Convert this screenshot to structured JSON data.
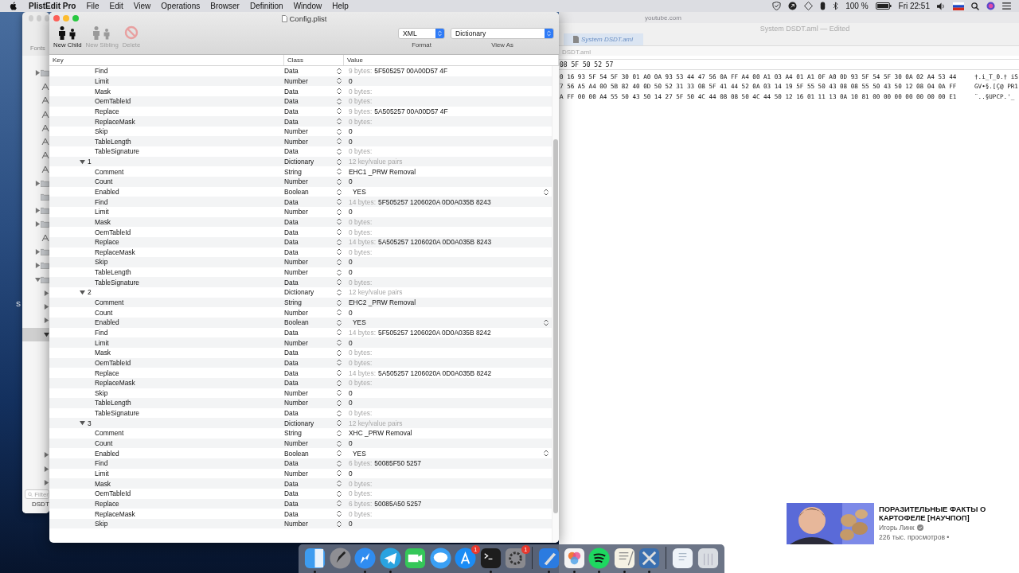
{
  "menubar": {
    "app_name": "PlistEdit Pro",
    "menus": [
      "File",
      "Edit",
      "View",
      "Operations",
      "Browser",
      "Definition",
      "Window",
      "Help"
    ],
    "battery_text": "100 %",
    "clock": "Fri 22:51"
  },
  "desktop": {
    "label": "S"
  },
  "back_window": {
    "toolbar_label": "Fonts",
    "filter_placeholder": "Filter",
    "bottom_tab": "DSDT",
    "items": [
      {
        "kind": "folder",
        "expanded": false
      },
      {
        "kind": "font"
      },
      {
        "kind": "font"
      },
      {
        "kind": "font"
      },
      {
        "kind": "font"
      },
      {
        "kind": "font"
      },
      {
        "kind": "font"
      },
      {
        "kind": "font"
      },
      {
        "kind": "folder",
        "expanded": false
      },
      {
        "kind": "folder"
      },
      {
        "kind": "folder",
        "expanded": false
      },
      {
        "kind": "folder",
        "expanded": false
      },
      {
        "kind": "font"
      },
      {
        "kind": "folder",
        "expanded": false
      },
      {
        "kind": "folder",
        "expanded": false
      },
      {
        "kind": "folder",
        "expanded": true,
        "children": [
          {
            "expanded": false,
            "selected": false
          },
          {
            "expanded": false,
            "selected": false
          },
          {
            "expanded": false,
            "selected": false
          },
          {
            "expanded": true,
            "selected": true
          }
        ]
      }
    ],
    "lower_items": [
      {
        "expanded": false
      },
      {
        "expanded": false
      },
      {
        "expanded": false
      }
    ]
  },
  "hex_window": {
    "address": "youtube.com",
    "title": "System DSDT.aml — Edited",
    "tab": "System DSDT.aml",
    "path": "DSDT.aml",
    "search": "08 5F 50 52 57",
    "rows": [
      {
        "hex": "0 16 93 5F 54 5F 30 01 A0 0A 93 53 44 47 56 0A FF A4 00 A1 03 A4 01 A1 0F A0 0D 93 5F 54 5F 30 0A 02 A4 53 44",
        "text": "†.i_T_0.† iS"
      },
      {
        "hex": "7 56 A5 A4 00 5B 82 40 0D 50 52 31 33 08 5F 41 44 52 0A 03 14 19 5F 55 50 43 08 08 55 50 43 50 12 08 04 0A FF",
        "text": "GV•§.[Ç@ PR1"
      },
      {
        "hex": "A FF 00 00 A4 55 50 43 50 14 27 5F 50 4C 44 08 08 50 4C 44 50 12 16 01 11 13 0A 10 81 00 00 00 00 00 00 00 E1",
        "text": "¨..§UPCP.'_"
      }
    ]
  },
  "video": {
    "title": "ПОРАЗИТЕЛЬНЫЕ ФАКТЫ О КАРТОФЕЛЕ [НАУЧПОП]",
    "channel": "Игорь Линк",
    "views": "226 тыс. просмотров •"
  },
  "window": {
    "title": "Config.plist",
    "toolbar": [
      {
        "label": "New Child",
        "kind": "child",
        "disabled": false
      },
      {
        "label": "New Sibling",
        "kind": "sibling",
        "disabled": true
      },
      {
        "label": "Delete",
        "kind": "delete",
        "disabled": true
      }
    ],
    "format": {
      "value": "XML",
      "label": "Format"
    },
    "view_as": {
      "value": "Dictionary",
      "label": "View As"
    }
  },
  "table": {
    "columns": [
      "Key",
      "Class",
      "Value"
    ],
    "rows": [
      {
        "key": "Find",
        "class": "Data",
        "kind": "data",
        "note": "9 bytes:",
        "value": "5F505257 00A00D57 4F"
      },
      {
        "key": "Limit",
        "class": "Number",
        "kind": "number",
        "value": "0"
      },
      {
        "key": "Mask",
        "class": "Data",
        "kind": "data",
        "note": "0 bytes:"
      },
      {
        "key": "OemTableId",
        "class": "Data",
        "kind": "data",
        "note": "0 bytes:"
      },
      {
        "key": "Replace",
        "class": "Data",
        "kind": "data",
        "note": "9 bytes:",
        "value": "5A505257 00A00D57 4F"
      },
      {
        "key": "ReplaceMask",
        "class": "Data",
        "kind": "data",
        "note": "0 bytes:"
      },
      {
        "key": "Skip",
        "class": "Number",
        "kind": "number",
        "value": "0"
      },
      {
        "key": "TableLength",
        "class": "Number",
        "kind": "number",
        "value": "0"
      },
      {
        "key": "TableSignature",
        "class": "Data",
        "kind": "data",
        "note": "0 bytes:"
      },
      {
        "key": "1",
        "class": "Dictionary",
        "kind": "dictionary",
        "note": "12 key/value pairs",
        "expanded": true,
        "children": [
          {
            "key": "Comment",
            "class": "String",
            "kind": "string",
            "value": "EHC1 _PRW Removal"
          },
          {
            "key": "Count",
            "class": "Number",
            "kind": "number",
            "value": "0"
          },
          {
            "key": "Enabled",
            "class": "Boolean",
            "kind": "boolean",
            "value": "YES"
          },
          {
            "key": "Find",
            "class": "Data",
            "kind": "data",
            "note": "14 bytes:",
            "value": "5F505257 1206020A 0D0A035B 8243"
          },
          {
            "key": "Limit",
            "class": "Number",
            "kind": "number",
            "value": "0"
          },
          {
            "key": "Mask",
            "class": "Data",
            "kind": "data",
            "note": "0 bytes:"
          },
          {
            "key": "OemTableId",
            "class": "Data",
            "kind": "data",
            "note": "0 bytes:"
          },
          {
            "key": "Replace",
            "class": "Data",
            "kind": "data",
            "note": "14 bytes:",
            "value": "5A505257 1206020A 0D0A035B 8243"
          },
          {
            "key": "ReplaceMask",
            "class": "Data",
            "kind": "data",
            "note": "0 bytes:"
          },
          {
            "key": "Skip",
            "class": "Number",
            "kind": "number",
            "value": "0"
          },
          {
            "key": "TableLength",
            "class": "Number",
            "kind": "number",
            "value": "0"
          },
          {
            "key": "TableSignature",
            "class": "Data",
            "kind": "data",
            "note": "0 bytes:"
          }
        ]
      },
      {
        "key": "2",
        "class": "Dictionary",
        "kind": "dictionary",
        "note": "12 key/value pairs",
        "expanded": true,
        "children": [
          {
            "key": "Comment",
            "class": "String",
            "kind": "string",
            "value": "EHC2 _PRW Removal"
          },
          {
            "key": "Count",
            "class": "Number",
            "kind": "number",
            "value": "0"
          },
          {
            "key": "Enabled",
            "class": "Boolean",
            "kind": "boolean",
            "value": "YES"
          },
          {
            "key": "Find",
            "class": "Data",
            "kind": "data",
            "note": "14 bytes:",
            "value": "5F505257 1206020A 0D0A035B 8242"
          },
          {
            "key": "Limit",
            "class": "Number",
            "kind": "number",
            "value": "0"
          },
          {
            "key": "Mask",
            "class": "Data",
            "kind": "data",
            "note": "0 bytes:"
          },
          {
            "key": "OemTableId",
            "class": "Data",
            "kind": "data",
            "note": "0 bytes:"
          },
          {
            "key": "Replace",
            "class": "Data",
            "kind": "data",
            "note": "14 bytes:",
            "value": "5A505257 1206020A 0D0A035B 8242"
          },
          {
            "key": "ReplaceMask",
            "class": "Data",
            "kind": "data",
            "note": "0 bytes:"
          },
          {
            "key": "Skip",
            "class": "Number",
            "kind": "number",
            "value": "0"
          },
          {
            "key": "TableLength",
            "class": "Number",
            "kind": "number",
            "value": "0"
          },
          {
            "key": "TableSignature",
            "class": "Data",
            "kind": "data",
            "note": "0 bytes:"
          }
        ]
      },
      {
        "key": "3",
        "class": "Dictionary",
        "kind": "dictionary",
        "note": "12 key/value pairs",
        "expanded": true,
        "children": [
          {
            "key": "Comment",
            "class": "String",
            "kind": "string",
            "value": "XHC _PRW Removal"
          },
          {
            "key": "Count",
            "class": "Number",
            "kind": "number",
            "value": "0"
          },
          {
            "key": "Enabled",
            "class": "Boolean",
            "kind": "boolean",
            "value": "YES"
          },
          {
            "key": "Find",
            "class": "Data",
            "kind": "data",
            "note": "6 bytes:",
            "value": "50085F50 5257"
          },
          {
            "key": "Limit",
            "class": "Number",
            "kind": "number",
            "value": "0"
          },
          {
            "key": "Mask",
            "class": "Data",
            "kind": "data",
            "note": "0 bytes:"
          },
          {
            "key": "OemTableId",
            "class": "Data",
            "kind": "data",
            "note": "0 bytes:"
          },
          {
            "key": "Replace",
            "class": "Data",
            "kind": "data",
            "note": "6 bytes:",
            "value": "50085A50 5257"
          },
          {
            "key": "ReplaceMask",
            "class": "Data",
            "kind": "data",
            "note": "0 bytes:"
          },
          {
            "key": "Skip",
            "class": "Number",
            "kind": "number",
            "value": "0"
          }
        ]
      }
    ]
  },
  "dock": [
    {
      "kind": "finder",
      "running": true
    },
    {
      "kind": "launchpad",
      "running": false
    },
    {
      "kind": "safari",
      "running": true
    },
    {
      "kind": "telegram",
      "running": true
    },
    {
      "kind": "facetime",
      "running": false
    },
    {
      "kind": "messages",
      "running": false
    },
    {
      "kind": "appstore",
      "running": false,
      "badge": "1"
    },
    {
      "kind": "terminal",
      "running": true
    },
    {
      "kind": "sysprefs",
      "running": false,
      "badge": "1"
    },
    {
      "kind": "separator"
    },
    {
      "kind": "xcode",
      "running": true
    },
    {
      "kind": "pixelmator",
      "running": true
    },
    {
      "kind": "spotify",
      "running": true
    },
    {
      "kind": "textedit",
      "running": true
    },
    {
      "kind": "utilities",
      "running": true
    },
    {
      "kind": "separator"
    },
    {
      "kind": "document",
      "running": false
    },
    {
      "kind": "trash",
      "running": false
    }
  ]
}
